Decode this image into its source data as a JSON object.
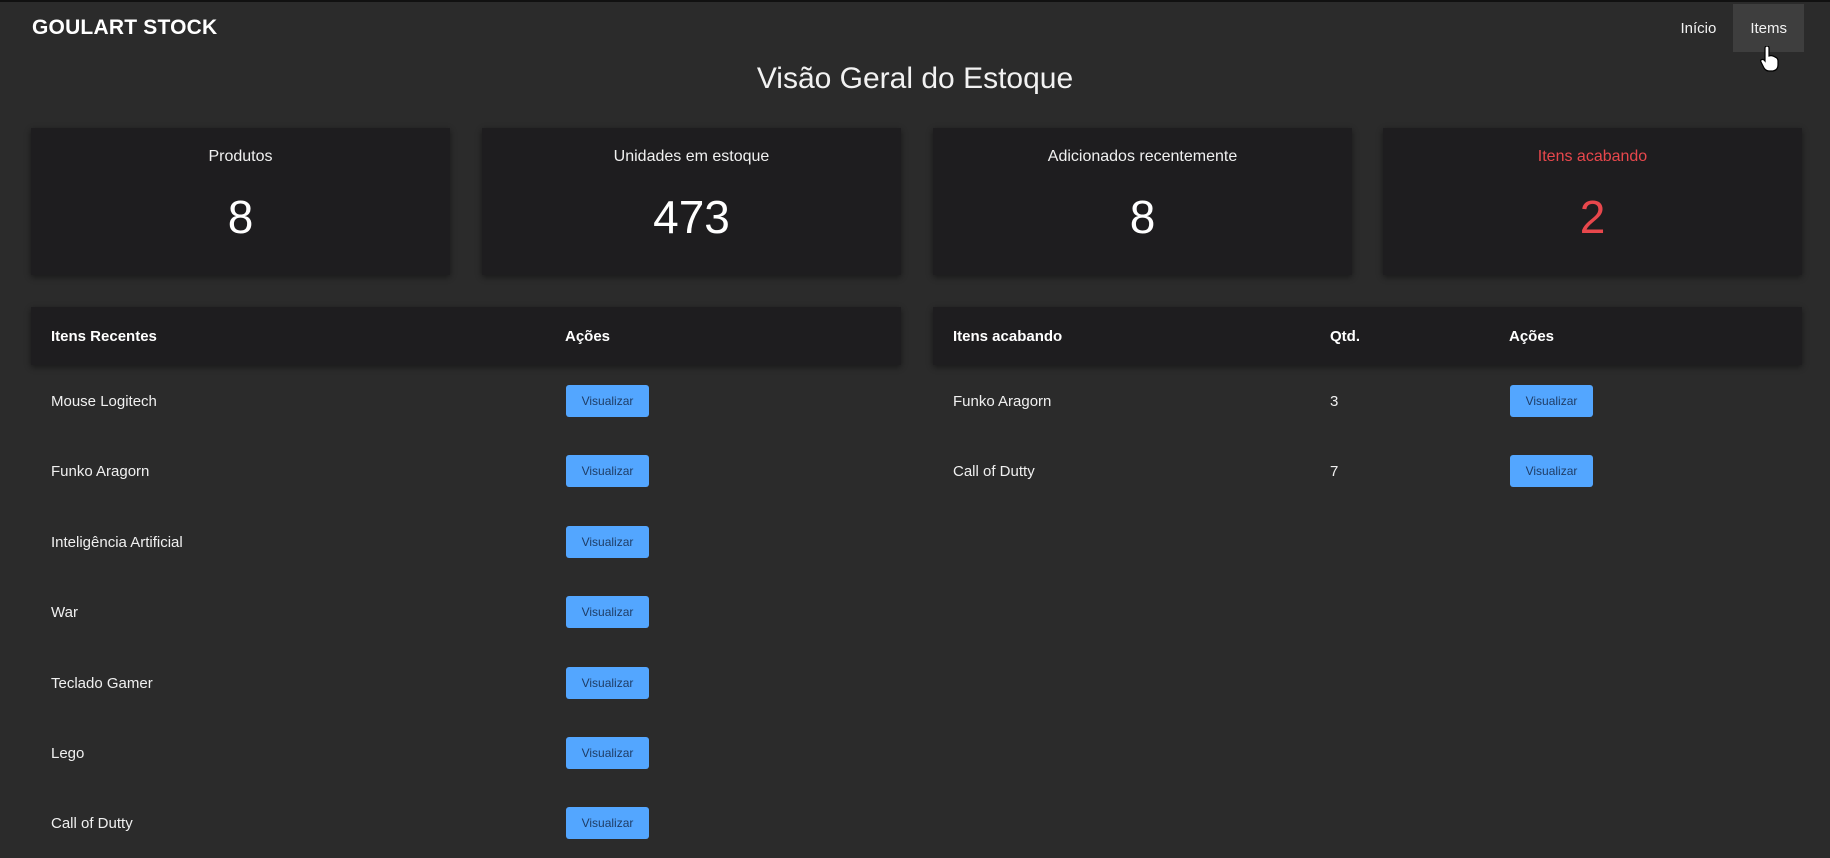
{
  "navbar": {
    "brand": "GOULART STOCK",
    "links": [
      {
        "label": "Início"
      },
      {
        "label": "Items"
      }
    ]
  },
  "page_title": "Visão Geral do Estoque",
  "cards": [
    {
      "label": "Produtos",
      "value": "8"
    },
    {
      "label": "Unidades em estoque",
      "value": "473"
    },
    {
      "label": "Adicionados recentemente",
      "value": "8"
    },
    {
      "label": "Itens acabando",
      "value": "2"
    }
  ],
  "colors": {
    "background": "#2b2b2b",
    "card": "#1e1d1f",
    "button": "#53a6ff",
    "alert": "#e8474c"
  },
  "recent_table": {
    "headers": [
      "Itens Recentes",
      "Ações"
    ],
    "rows": [
      {
        "name": "Mouse Logitech",
        "action": "Visualizar"
      },
      {
        "name": "Funko Aragorn",
        "action": "Visualizar"
      },
      {
        "name": "Inteligência Artificial",
        "action": "Visualizar"
      },
      {
        "name": "War",
        "action": "Visualizar"
      },
      {
        "name": "Teclado Gamer",
        "action": "Visualizar"
      },
      {
        "name": "Lego",
        "action": "Visualizar"
      },
      {
        "name": "Call of Dutty",
        "action": "Visualizar"
      }
    ]
  },
  "low_table": {
    "headers": [
      "Itens acabando",
      "Qtd.",
      "Ações"
    ],
    "rows": [
      {
        "name": "Funko Aragorn",
        "qty": "3",
        "action": "Visualizar"
      },
      {
        "name": "Call of Dutty",
        "qty": "7",
        "action": "Visualizar"
      }
    ]
  }
}
